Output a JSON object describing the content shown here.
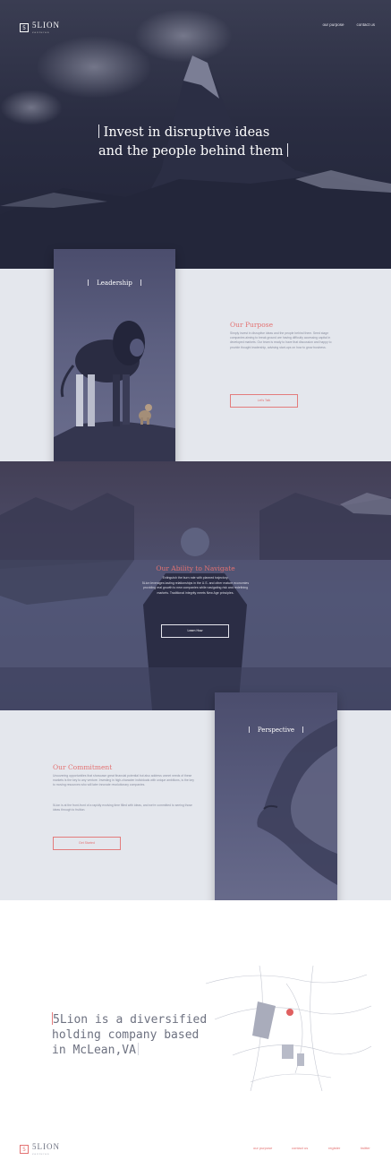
{
  "brand": {
    "name": "5LION",
    "mark": "5",
    "tagline": "ventures",
    "accent": "#e37272",
    "dark": "#2a2d42"
  },
  "header": {
    "nav": [
      "our purpose",
      "contact us"
    ]
  },
  "hero": {
    "title_line1": "Invest in disruptive ideas",
    "title_line2": "and the people behind them"
  },
  "leadership": {
    "card_title": "Leadership",
    "heading": "Our Purpose",
    "body": "Simply invest in disruptive ideas and the people behind them. Seed stage companies aiming to break ground are having difficulty accessing capital in developed markets. Our team is ready to have that discussion and happy to provide thought leadership, advising start-ups on how to grow business.",
    "button": "Let's Talk"
  },
  "navigate": {
    "heading": "Our Ability to Navigate",
    "body_line1": "Extinguish the burn rate with planned trajectory.",
    "body_line2": "5Lion leverages lasting relationships in the U.S. and other mature economies",
    "body_line3": "providing real growth to new companies while navigating risk and redefining",
    "body_line4": "markets. Traditional integrity meets New Age principles.",
    "button": "Learn How"
  },
  "commitment": {
    "card_title": "Perspective",
    "heading": "Our Commitment",
    "body1": "Uncovering opportunities that showcase great financial potential but also address unmet needs of these markets is the key to any venture. Investing in high-character individuals with unique ambitions, is the key to moving resources who will later innovate revolutionary companies.",
    "body2": "5Lion is at the front-front of a rapidly evolving time filled with ideas, and we're committed to seeing those ideas through to fruition.",
    "button": "Get Started"
  },
  "about": {
    "line1": "5Lion is a diversified",
    "line2": "holding company based",
    "line3": "in McLean,VA"
  },
  "footer": {
    "nav": [
      "our purpose",
      "contact us",
      "register",
      "twitter"
    ]
  }
}
